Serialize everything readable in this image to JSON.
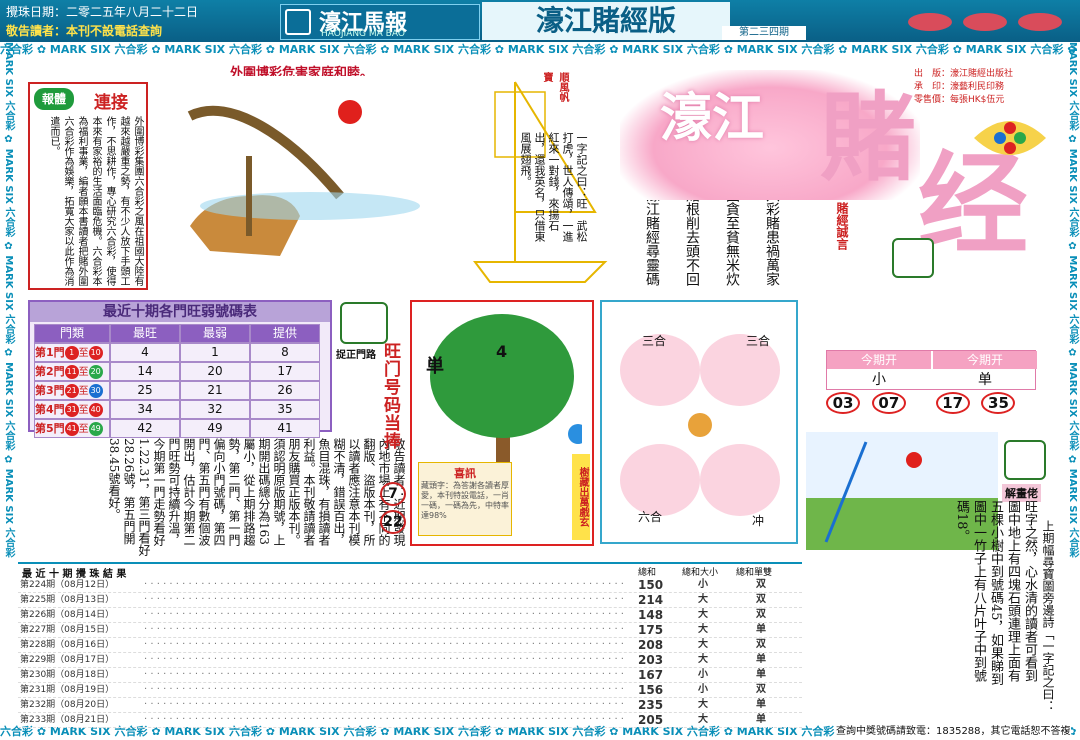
{
  "header": {
    "date": "攪珠日期：二零二五年八月二十二日",
    "notice": "敬告讀者：本刊不設電話查詢",
    "logo_cn": "濠江馬報",
    "logo_en": "HAOJIANG MA BAO",
    "version": "濠江賭經版",
    "issue": "第二三四期"
  },
  "band_text": "六合彩 ✿ MARK SIX 六合彩 ✿ MARK SIX 六合彩 ✿ MARK SIX 六合彩 ✿ MARK SIX 六合彩 ✿ MARK SIX 六合彩 ✿ MARK SIX 六合彩 ✿ MARK SIX 六合彩 ✿ MARK SIX 六合彩 ✿ MARK SIX 六合彩 ✿ MARK SIX",
  "side_band": "MARK SIX 六合彩 ✿ MARK SIX 六合彩 ✿ MARK SIX 六合彩 ✿ MARK SIX 六合彩 ✿ MARK SIX 六合彩",
  "top_caption": "外圍博彩危害家庭和睦。",
  "serial": {
    "tag1": "報",
    "tag2": "體",
    "tag3": "連",
    "tag4": "接",
    "text": "外圍博彩集團六合彩之風在祖國大陸有越來越嚴重之勢，有不少人放下手頭工作，不思耕作，專心研究六合彩，使得本來有家裕的生活面臨危機。六合彩本為福利事業，編者願本書讀者把賭外圍六合彩作為娛樂，拓寬大家以此作為消遣而已。"
  },
  "boat": {
    "tag": "順風帆寶",
    "poem": "一字記之曰：旺　武松打虎，世人傳頌，一進紅來一對錢，來揚石出，還我英名，只借東風展翅飛。"
  },
  "verses": [
    "六彩賭患禍萬家",
    "困貪至貧無米炊",
    "賭根削去頭不回",
    "濠江賭經尋靈碼"
  ],
  "logo_big": {
    "a": "濠江",
    "b": "賭",
    "c": "经",
    "sub": "賭經誠言"
  },
  "publisher": {
    "l1": "出　版：濠江賭經出版社",
    "l2": "承　印：濠藝利民印務",
    "l3": "零售價：每張HK$伍元"
  },
  "table": {
    "title": "最近十期各門旺弱號碼表",
    "headers": [
      "門類",
      "最旺",
      "最弱",
      "提供"
    ],
    "rows": [
      {
        "door": "第1門",
        "a": "1",
        "b": "10",
        "hot": "4",
        "cold": "1",
        "give": "8"
      },
      {
        "door": "第2門",
        "a": "11",
        "b": "20",
        "hot": "14",
        "cold": "20",
        "give": "17"
      },
      {
        "door": "第3門",
        "a": "21",
        "b": "30",
        "hot": "25",
        "cold": "21",
        "give": "26"
      },
      {
        "door": "第4門",
        "a": "31",
        "b": "40",
        "hot": "34",
        "cold": "32",
        "give": "35"
      },
      {
        "door": "第5門",
        "a": "41",
        "b": "49",
        "hot": "42",
        "cold": "49",
        "give": "41"
      }
    ],
    "zhi": "至"
  },
  "door_tag": "捉正門路",
  "article": "敬告讀者：近期發現內地市場上有不同的翻版、盜版本刊，所以讀者應注意本刊模糊不清，錯誤百出，魚目混珠，有損讀者利益。本刊敬請讀者朋友購買正版本刊。須認明原版期號，上期開出碼總分為163屬小，從上期排路趨勢，第二門、第一門偏向小門號碼，第四門、第五門有數個波開出，估計今期第二門旺勢可持續升溫，今期第一門走勢看好1.22.31，第三門看好28.26號，第五門開38.45號看好。",
  "vert_title": "旺门号码当捧",
  "vert_nums": [
    "7",
    "22"
  ],
  "tree": {
    "tag_top": "単",
    "num": "4",
    "joy_title": "喜訊",
    "joy_text": "藏頭字：為答謝各讀者厚愛，本刊特設電話，一肖一碼，一碼為先，中特率達98%",
    "right_tag": "樹藏出萬戲玄"
  },
  "zodiac": {
    "l1": "三合",
    "l2": "三合",
    "l3": "六合",
    "l4": "冲"
  },
  "this_issue": {
    "h1": "今期开",
    "h2": "今期开",
    "v1": "小",
    "v2": "单",
    "balls": [
      "03",
      "07",
      "17",
      "35"
    ]
  },
  "solve": {
    "tag": "解畫佬",
    "text": "旺字之然，心水清的讀者可看到圖中地上有四塊石頭連理上面有五棵小樹中到號碼45，如果睇到圖中一竹子上有八片叶子中到號碼18。",
    "hint": "上期幅尋寶圖旁邊詩「一字記之曰：",
    "hint2": "旺」"
  },
  "results": {
    "title": "最 近 十 期 攪 珠 結 果",
    "hdr_sum": "總和",
    "hdr_bs": "總和大小",
    "hdr_oe": "總和單雙",
    "rows": [
      {
        "label": "第224期（08月12日）",
        "sum": "150",
        "bs": "小",
        "oe": "双"
      },
      {
        "label": "第225期（08月13日）",
        "sum": "214",
        "bs": "大",
        "oe": "双"
      },
      {
        "label": "第226期（08月14日）",
        "sum": "148",
        "bs": "大",
        "oe": "双"
      },
      {
        "label": "第227期（08月15日）",
        "sum": "175",
        "bs": "大",
        "oe": "单"
      },
      {
        "label": "第228期（08月16日）",
        "sum": "208",
        "bs": "大",
        "oe": "双"
      },
      {
        "label": "第229期（08月17日）",
        "sum": "203",
        "bs": "大",
        "oe": "单"
      },
      {
        "label": "第230期（08月18日）",
        "sum": "167",
        "bs": "小",
        "oe": "单"
      },
      {
        "label": "第231期（08月19日）",
        "sum": "156",
        "bs": "小",
        "oe": "双"
      },
      {
        "label": "第232期（08月20日）",
        "sum": "235",
        "bs": "大",
        "oe": "单"
      },
      {
        "label": "第233期（08月21日）",
        "sum": "205",
        "bs": "大",
        "oe": "单"
      }
    ],
    "dots": "· · · · · · · · · · · · · · · · · · · · · · · · · · · · · · · · · · · · · · · · · · · · · · · · · · · · · · · · · · · · · · · · · · · · · · · · · · · · · · · · ·"
  },
  "footer": "查詢中獎號碼請致電：1835288，其它電話恕不答複",
  "colors": {
    "teal": "#0a5f86",
    "pink": "#f0a0c4",
    "purple": "#8c5fc0",
    "red": "#d22222"
  },
  "icons": [
    "book-icon",
    "hand-icon",
    "flower-icon"
  ]
}
